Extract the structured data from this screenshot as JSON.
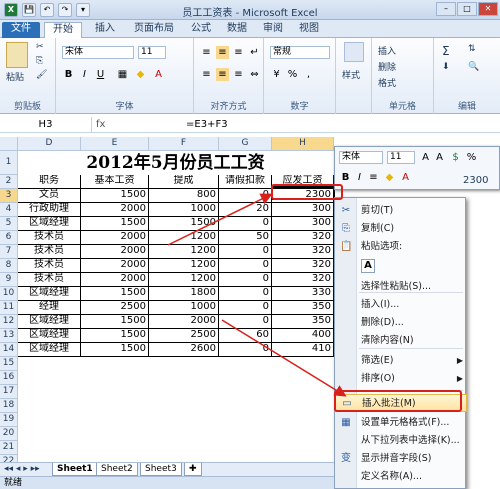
{
  "window": {
    "title": "员工工资表 - Microsoft Excel",
    "qa_save": "💾",
    "qa_undo": "↶",
    "qa_redo": "↷",
    "qa_more": "▾",
    "min": "–",
    "max": "□",
    "close": "✕"
  },
  "tabs": [
    "文件",
    "开始",
    "插入",
    "页面布局",
    "公式",
    "数据",
    "审阅",
    "视图"
  ],
  "ribbon": {
    "paste": "粘贴",
    "clipboard": "剪贴板",
    "font_name": "宋体",
    "font_size": "11",
    "bold": "B",
    "italic": "I",
    "underline": "U",
    "font_group": "字体",
    "align_group": "对齐方式",
    "number_format": "常规",
    "number_group": "数字",
    "percent": "%",
    "comma": ",",
    "style": "样式",
    "insert": "插入",
    "delete": "删除",
    "format": "格式",
    "cells_group": "单元格",
    "edit_group": "编辑",
    "sigma": "Σ"
  },
  "formula_bar": {
    "name_box": "H3",
    "fx": "fx",
    "formula": "=E3+F3"
  },
  "columns": [
    "D",
    "E",
    "F",
    "G",
    "H"
  ],
  "rows": [
    "1",
    "2",
    "3",
    "4",
    "5",
    "6",
    "7",
    "8",
    "9",
    "10",
    "11",
    "12",
    "13",
    "14",
    "15",
    "16",
    "17",
    "18",
    "19",
    "20",
    "21",
    "22"
  ],
  "sheet": {
    "title": "2012年5月份员工工资",
    "headers": [
      "职务",
      "基本工资",
      "提成",
      "请假扣款",
      "应发工资"
    ],
    "data": [
      [
        "文员",
        "1500",
        "800",
        "0",
        "2300"
      ],
      [
        "行政助理",
        "2000",
        "1000",
        "20",
        "300"
      ],
      [
        "区域经理",
        "1500",
        "1500",
        "0",
        "300"
      ],
      [
        "技术员",
        "2000",
        "1200",
        "50",
        "320"
      ],
      [
        "技术员",
        "2000",
        "1200",
        "0",
        "320"
      ],
      [
        "技术员",
        "2000",
        "1200",
        "0",
        "320"
      ],
      [
        "技术员",
        "2000",
        "1200",
        "0",
        "320"
      ],
      [
        "区域经理",
        "1500",
        "1800",
        "0",
        "330"
      ],
      [
        "经理",
        "2500",
        "1000",
        "0",
        "350"
      ],
      [
        "区域经理",
        "1500",
        "2000",
        "0",
        "350"
      ],
      [
        "区域经理",
        "1500",
        "2500",
        "60",
        "400"
      ],
      [
        "区域经理",
        "1500",
        "2600",
        "0",
        "410"
      ]
    ]
  },
  "mini_toolbar": {
    "font": "宋体",
    "size": "11",
    "bold": "B",
    "italic": "I",
    "align": "≡",
    "value": "2300"
  },
  "context_menu": {
    "items": [
      {
        "icon": "✂",
        "label": "剪切(T)"
      },
      {
        "icon": "⎘",
        "label": "复制(C)"
      },
      {
        "icon": "📋",
        "label": "粘贴选项:"
      },
      {
        "icon": "A",
        "label": ""
      },
      {
        "icon": "",
        "label": "选择性粘贴(S)..."
      },
      {
        "icon": "",
        "label": "插入(I)..."
      },
      {
        "icon": "",
        "label": "删除(D)..."
      },
      {
        "icon": "",
        "label": "清除内容(N)"
      },
      {
        "icon": "",
        "label": "筛选(E)"
      },
      {
        "icon": "",
        "label": "排序(O)"
      },
      {
        "icon": "▭",
        "label": "插入批注(M)"
      },
      {
        "icon": "▦",
        "label": "设置单元格格式(F)..."
      },
      {
        "icon": "",
        "label": "从下拉列表中选择(K)..."
      },
      {
        "icon": "变",
        "label": "显示拼音字段(S)"
      },
      {
        "icon": "",
        "label": "定义名称(A)..."
      }
    ]
  },
  "sheets": [
    "Sheet1",
    "Sheet2",
    "Sheet3"
  ],
  "status": "就绪"
}
